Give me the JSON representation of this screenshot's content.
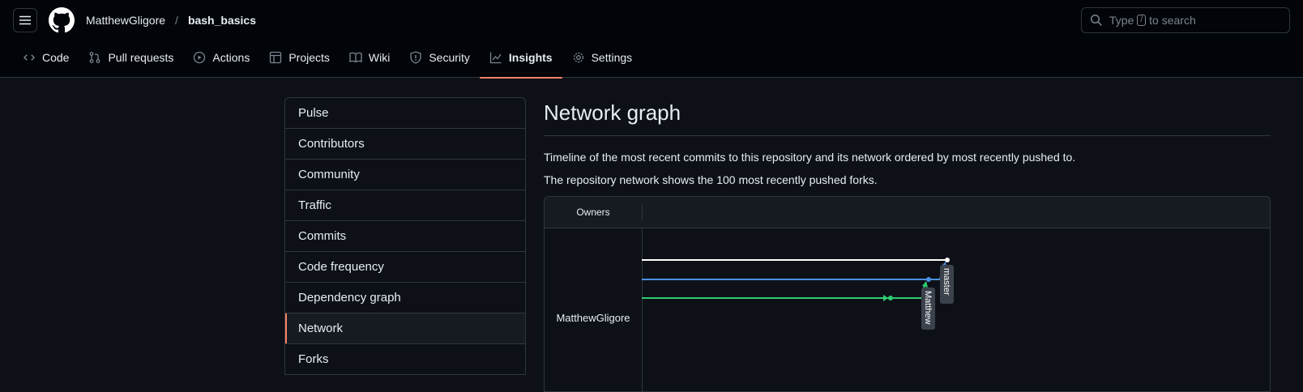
{
  "header": {
    "owner": "MatthewGligore",
    "separator": "/",
    "repo": "bash_basics",
    "search_prefix": "Type",
    "search_key": "/",
    "search_suffix": "to search"
  },
  "tabs": [
    "Code",
    "Pull requests",
    "Actions",
    "Projects",
    "Wiki",
    "Security",
    "Insights",
    "Settings"
  ],
  "active_tab": "Insights",
  "sidebar": {
    "items": [
      "Pulse",
      "Contributors",
      "Community",
      "Traffic",
      "Commits",
      "Code frequency",
      "Dependency graph",
      "Network",
      "Forks"
    ],
    "selected": "Network"
  },
  "main": {
    "title": "Network graph",
    "desc1": "Timeline of the most recent commits to this repository and its network ordered by most recently pushed to.",
    "desc2": "The repository network shows the 100 most recently pushed forks.",
    "graph": {
      "owners_header": "Owners",
      "owner_name": "MatthewGligore",
      "branch_labels": [
        "master",
        "Matthew"
      ],
      "colors": {
        "white": "#ffffff",
        "blue": "#4a90e2",
        "green": "#2ecc71",
        "accent": "#f78166"
      }
    }
  }
}
